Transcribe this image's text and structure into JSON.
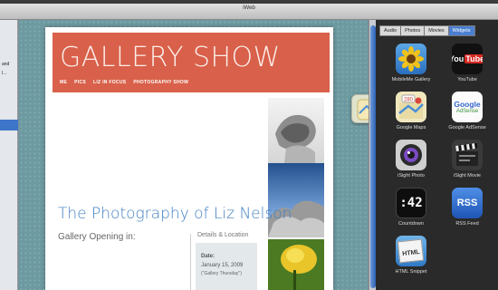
{
  "window": {
    "title": "iWeb"
  },
  "sidebar": {
    "labels": [
      "and",
      "l..."
    ]
  },
  "page": {
    "headline": "GALLERY SHOW",
    "nav": [
      "ME",
      "PICS",
      "LIZ IN FOCUS",
      "PHOTOGRAPHY SHOW"
    ],
    "title": "The Photography of Liz Nelson",
    "opening": "Gallery Opening in:",
    "details": {
      "heading": "Details & Location",
      "date_label": "Date:",
      "date": "January 15, 2009",
      "date_note": "(\"Gallery Thursday\")"
    }
  },
  "media_browser": {
    "tabs": [
      "Audio",
      "Photos",
      "Movies",
      "Widgets"
    ],
    "active_tab": "Widgets",
    "widgets": [
      {
        "label": "MobileMe Gallery",
        "icon": "sunflower-icon"
      },
      {
        "label": "YouTube",
        "icon": "youtube-icon",
        "text": "You Tube"
      },
      {
        "label": "Google Maps",
        "icon": "google-maps-icon",
        "text": "280"
      },
      {
        "label": "Google AdSense",
        "icon": "google-adsense-icon",
        "text": "Google AdSense"
      },
      {
        "label": "iSight Photo",
        "icon": "isight-photo-icon"
      },
      {
        "label": "iSight Movie",
        "icon": "clapperboard-icon"
      },
      {
        "label": "Countdown",
        "icon": "countdown-icon",
        "text": ":42"
      },
      {
        "label": "RSS Feed",
        "icon": "rss-icon",
        "text": "RSS"
      },
      {
        "label": "HTML Snippet",
        "icon": "html-snippet-icon",
        "text": "HTML"
      }
    ]
  },
  "colors": {
    "banner": "#d9604a",
    "title_blue": "#3f7fc1",
    "tab_active": "#4b7fd0"
  }
}
